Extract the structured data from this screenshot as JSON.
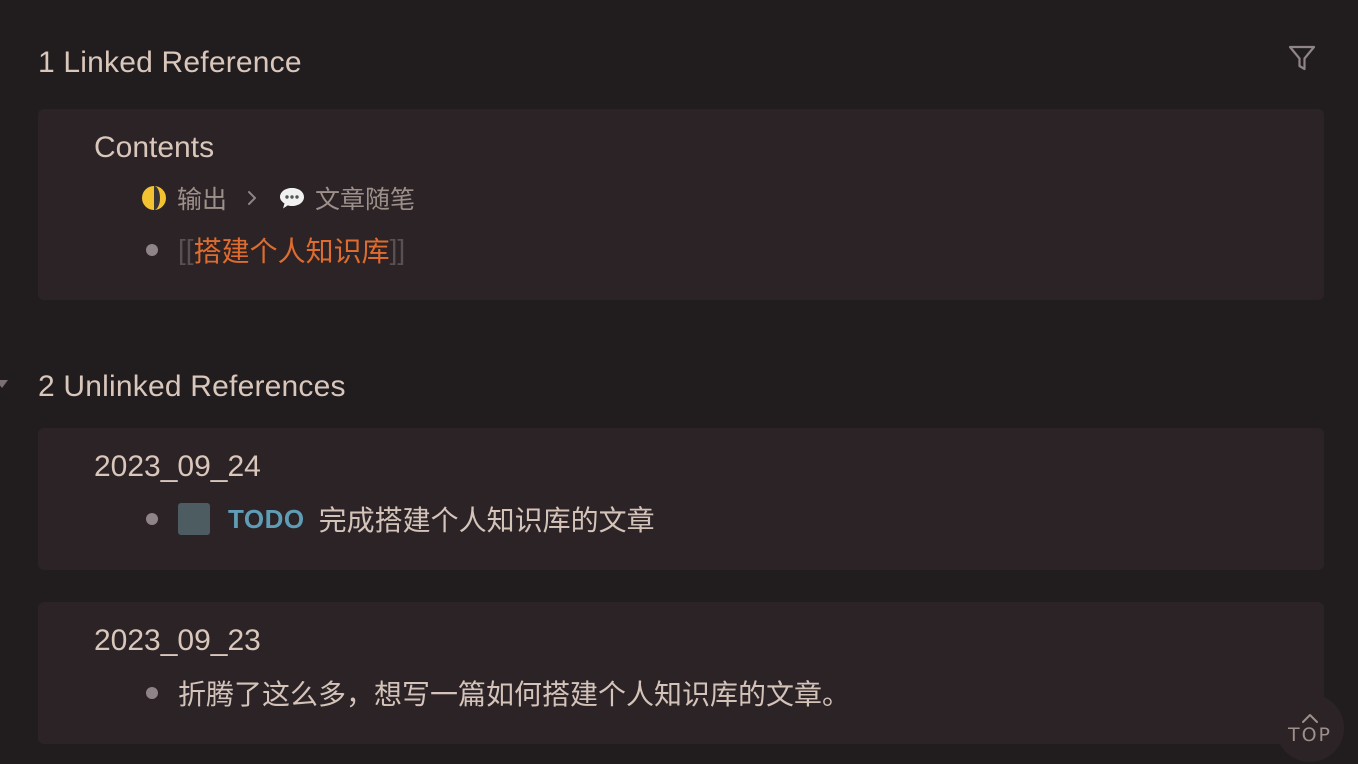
{
  "linked": {
    "title": "1 Linked Reference",
    "card": {
      "page_title": "Contents",
      "breadcrumb": [
        {
          "emoji": "crescent-moon-icon",
          "label": "输出"
        },
        {
          "emoji": "speech-bubble-icon",
          "label": "文章随笔"
        }
      ],
      "block": {
        "bracket_open": "[[",
        "ref": "搭建个人知识库",
        "bracket_close": "]]"
      }
    }
  },
  "unlinked": {
    "title": "2 Unlinked References",
    "cards": [
      {
        "page_title": "2023_09_24",
        "block": {
          "marker": "TODO",
          "text": "完成搭建个人知识库的文章"
        }
      },
      {
        "page_title": "2023_09_23",
        "block": {
          "text": "折腾了这么多，想写一篇如何搭建个人知识库的文章。"
        }
      }
    ]
  },
  "top_button": {
    "label": "TOP"
  },
  "colors": {
    "background": "#211d1e",
    "card": "#2b2326",
    "page_ref": "#de6c2e",
    "todo": "#5f9cb6",
    "checkbox": "#4d5c61"
  }
}
